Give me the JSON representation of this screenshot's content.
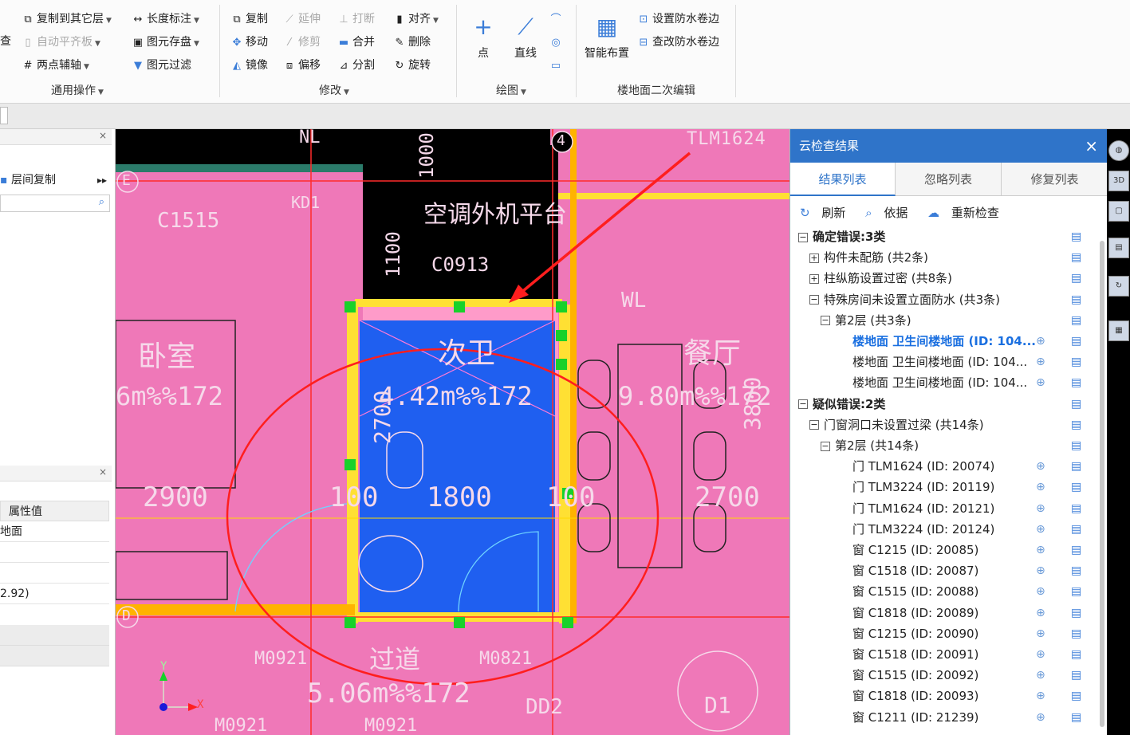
{
  "ribbon": {
    "common_ops": {
      "label": "通用操作",
      "copy_to_layer": "复制到其它层",
      "auto_align": "自动平齐板",
      "two_point_axis": "两点辅轴",
      "length_mark": "长度标注",
      "elem_save": "图元存盘",
      "elem_filter": "图元过滤",
      "left_cut_1": "查"
    },
    "modify": {
      "label": "修改",
      "copy": "复制",
      "extend": "延伸",
      "break": "打断",
      "align": "对齐",
      "move": "移动",
      "trim": "修剪",
      "merge": "合并",
      "delete": "删除",
      "mirror": "镜像",
      "offset": "偏移",
      "split": "分割",
      "rotate": "旋转"
    },
    "draw": {
      "label": "绘图",
      "point": "点",
      "line": "直线"
    },
    "floor_edit": {
      "label": "楼地面二次编辑",
      "smart_layout": "智能布置",
      "set_waterproof": "设置防水卷边",
      "view_waterproof": "查改防水卷边"
    }
  },
  "left": {
    "layer_copy": "层间复制",
    "search_placeholder": "",
    "prop_header": "属性值",
    "prop_vals": [
      "地面",
      "",
      "",
      "2.92)"
    ]
  },
  "canvas": {
    "labels": {
      "nl": "NL",
      "tlm": "TLM1624",
      "e": "E",
      "kd1": "KD1",
      "c1515": "C1515",
      "ac": "空调外机平台",
      "c0913": "C0913",
      "four": "4",
      "wl": "WL",
      "bedroom": "卧室",
      "bathroom": "次卫",
      "dining": "餐厅",
      "area_left": "6m%%172",
      "area_bath": "4.42m%%172",
      "area_dining": "9.80m%%172",
      "d2900": "2900",
      "d1800": "1800",
      "d2700": "2700",
      "d100a": "100",
      "d100b": "100",
      "d2700v": "2700",
      "d3800": "3800",
      "d1100": "1100",
      "d1000": "1000",
      "d": "D",
      "m0921a": "M0921",
      "m0821": "M0821",
      "corridor": "过道",
      "area_bottom": "5.06m%%172",
      "dd2": "DD2",
      "d1": "D1",
      "m0921b": "M0921",
      "m0921c": "M0921",
      "x_axis": "X",
      "y_axis": "Y"
    }
  },
  "right_panel": {
    "title": "云检查结果",
    "tabs": [
      "结果列表",
      "忽略列表",
      "修复列表"
    ],
    "tools": {
      "refresh": "刷新",
      "basis": "依据",
      "recheck": "重新检查"
    },
    "rows": [
      {
        "indent": 0,
        "toggle": "⊟",
        "text": "确定错误:3类",
        "bold": true
      },
      {
        "indent": 1,
        "toggle": "⊞",
        "text": "构件未配筋 (共2条)"
      },
      {
        "indent": 1,
        "toggle": "⊞",
        "text": "柱纵筋设置过密 (共8条)"
      },
      {
        "indent": 1,
        "toggle": "⊟",
        "text": "特殊房间未设置立面防水 (共3条)"
      },
      {
        "indent": 2,
        "toggle": "⊟",
        "text": "第2层 (共3条)"
      },
      {
        "indent": 3,
        "toggle": "",
        "text": "楼地面 卫生间楼地面 (ID: 104...",
        "selected": true,
        "loc": true
      },
      {
        "indent": 3,
        "toggle": "",
        "text": "楼地面 卫生间楼地面 (ID: 104...",
        "loc": true
      },
      {
        "indent": 3,
        "toggle": "",
        "text": "楼地面 卫生间楼地面 (ID: 104...",
        "loc": true
      },
      {
        "indent": 0,
        "toggle": "⊟",
        "text": "疑似错误:2类",
        "bold": true
      },
      {
        "indent": 1,
        "toggle": "⊟",
        "text": "门窗洞口未设置过梁 (共14条)"
      },
      {
        "indent": 2,
        "toggle": "⊟",
        "text": "第2层 (共14条)"
      },
      {
        "indent": 3,
        "toggle": "",
        "text": "门 TLM1624 (ID: 20074)",
        "loc": true
      },
      {
        "indent": 3,
        "toggle": "",
        "text": "门 TLM3224 (ID: 20119)",
        "loc": true
      },
      {
        "indent": 3,
        "toggle": "",
        "text": "门 TLM1624 (ID: 20121)",
        "loc": true
      },
      {
        "indent": 3,
        "toggle": "",
        "text": "门 TLM3224 (ID: 20124)",
        "loc": true
      },
      {
        "indent": 3,
        "toggle": "",
        "text": "窗 C1215 (ID: 20085)",
        "loc": true
      },
      {
        "indent": 3,
        "toggle": "",
        "text": "窗 C1518 (ID: 20087)",
        "loc": true
      },
      {
        "indent": 3,
        "toggle": "",
        "text": "窗 C1515 (ID: 20088)",
        "loc": true
      },
      {
        "indent": 3,
        "toggle": "",
        "text": "窗 C1818 (ID: 20089)",
        "loc": true
      },
      {
        "indent": 3,
        "toggle": "",
        "text": "窗 C1215 (ID: 20090)",
        "loc": true
      },
      {
        "indent": 3,
        "toggle": "",
        "text": "窗 C1518 (ID: 20091)",
        "loc": true
      },
      {
        "indent": 3,
        "toggle": "",
        "text": "窗 C1515 (ID: 20092)",
        "loc": true
      },
      {
        "indent": 3,
        "toggle": "",
        "text": "窗 C1818 (ID: 20093)",
        "loc": true
      },
      {
        "indent": 3,
        "toggle": "",
        "text": "窗 C1211 (ID: 21239)",
        "loc": true
      }
    ]
  },
  "colors": {
    "accent": "#2f74c9",
    "floor": "#ef78b8",
    "bathroom": "#1f5ff0",
    "annotation": "#ff2020"
  }
}
